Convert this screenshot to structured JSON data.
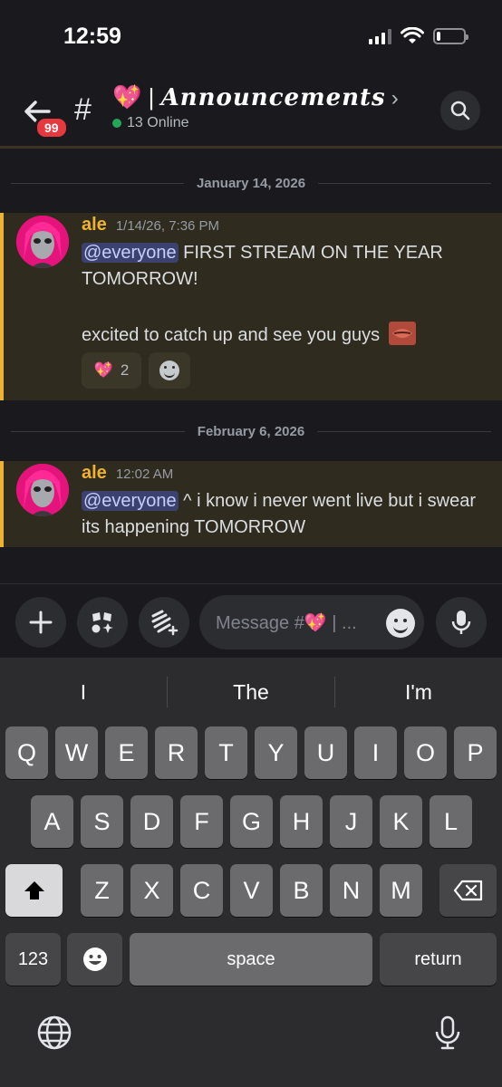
{
  "status_bar": {
    "time": "12:59",
    "battery_level": 0.15
  },
  "header": {
    "back_badge": "99",
    "hash": "#",
    "channel_emoji": "💖",
    "channel_separator": " | ",
    "channel_name": "Announcements",
    "chevron": "›",
    "online_text": "13 Online"
  },
  "messages": [
    {
      "date_divider": "January 14, 2026",
      "author": "ale",
      "timestamp": "1/14/26, 7:36 PM",
      "mention": "@everyone",
      "text_line1": " FIRST STREAM ON THE YEAR TOMORROW!",
      "text_line2": "excited to catch up and see you guys",
      "reaction_emoji": "💖",
      "reaction_count": "2"
    },
    {
      "date_divider": "February 6, 2026",
      "author": "ale",
      "timestamp": "12:02 AM",
      "mention": "@everyone",
      "text_line1": " ^ i know i never went live but i swear its happening TOMORROW"
    }
  ],
  "composer": {
    "placeholder": "Message #💖 | ..."
  },
  "keyboard": {
    "suggestions": [
      "I",
      "The",
      "I'm"
    ],
    "row1": [
      "Q",
      "W",
      "E",
      "R",
      "T",
      "Y",
      "U",
      "I",
      "O",
      "P"
    ],
    "row2": [
      "A",
      "S",
      "D",
      "F",
      "G",
      "H",
      "J",
      "K",
      "L"
    ],
    "row3": [
      "Z",
      "X",
      "C",
      "V",
      "B",
      "N",
      "M"
    ],
    "numbers_label": "123",
    "space_label": "space",
    "return_label": "return"
  },
  "colors": {
    "background": "#1a1a1e",
    "highlight": "#2f2b1e",
    "highlight_bar": "#f0b232",
    "author": "#f0b232",
    "mention_bg": "#3c4270",
    "badge": "#e5393f",
    "online": "#23a55a"
  }
}
